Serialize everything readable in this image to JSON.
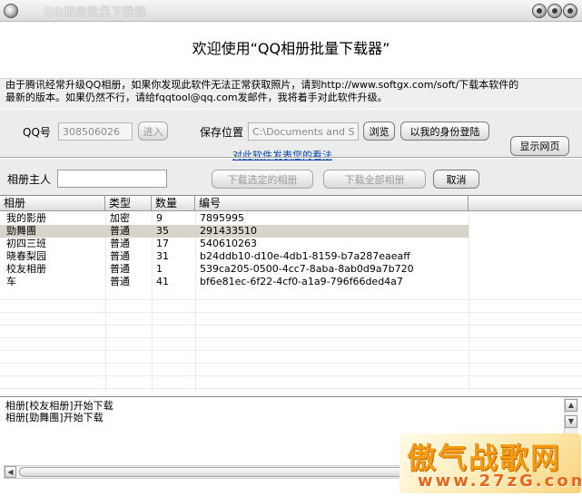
{
  "window": {
    "title": "QQ相册批量下载器",
    "icon": "app-eye-icon",
    "controls": [
      "minimize-icon",
      "maximize-icon",
      "close-icon"
    ]
  },
  "welcome": "欢迎使用“QQ相册批量下载器”",
  "info": {
    "line1": "由于腾讯经常升级QQ相册，如果你发现此软件无法正常获取照片，请到http://www.softgx.com/soft/下载本软件的",
    "line2": "最新的版本。如果仍然不行，请给fqqtool@qq.com发邮件，我将着手对此软件升级。"
  },
  "form": {
    "qq_label": "QQ号",
    "qq_value": "308506026",
    "enter_button": "进入",
    "save_label": "保存位置",
    "save_path": "C:\\Documents and Setti",
    "browse_button": "浏览",
    "login_button": "以我的身份登陆",
    "show_web_button": "显示网页",
    "feedback_link": "对此软件发表您的看法",
    "owner_label": "相册主人",
    "owner_value": "",
    "download_selected_button": "下载选定的相册",
    "download_all_button": "下载全部相册",
    "cancel_button": "取消"
  },
  "table": {
    "columns": [
      "相册",
      "类型",
      "数量",
      "编号"
    ],
    "rows": [
      {
        "name": "我的影册",
        "type": "加密",
        "count": "9",
        "id": "7895995"
      },
      {
        "name": "勁舞團",
        "type": "普通",
        "count": "35",
        "id": "291433510"
      },
      {
        "name": "初四三班",
        "type": "普通",
        "count": "17",
        "id": "540610263"
      },
      {
        "name": "晓春梨园",
        "type": "普通",
        "count": "31",
        "id": "b24ddb10-d10e-4db1-8159-b7a287eaeaff"
      },
      {
        "name": "校友相册",
        "type": "普通",
        "count": "1",
        "id": "539ca205-0500-4cc7-8aba-8ab0d9a7b720"
      },
      {
        "name": "车",
        "type": "普通",
        "count": "41",
        "id": "bf6e81ec-6f22-4cf0-a1a9-796f66ded4a7"
      }
    ],
    "selected_row": 1
  },
  "log": {
    "lines": [
      "相册[校友相册]开始下载",
      "相册[勁舞團]开始下载"
    ]
  },
  "watermark": {
    "main": "傲气战歌网",
    "sub": "www.27zG.com"
  }
}
